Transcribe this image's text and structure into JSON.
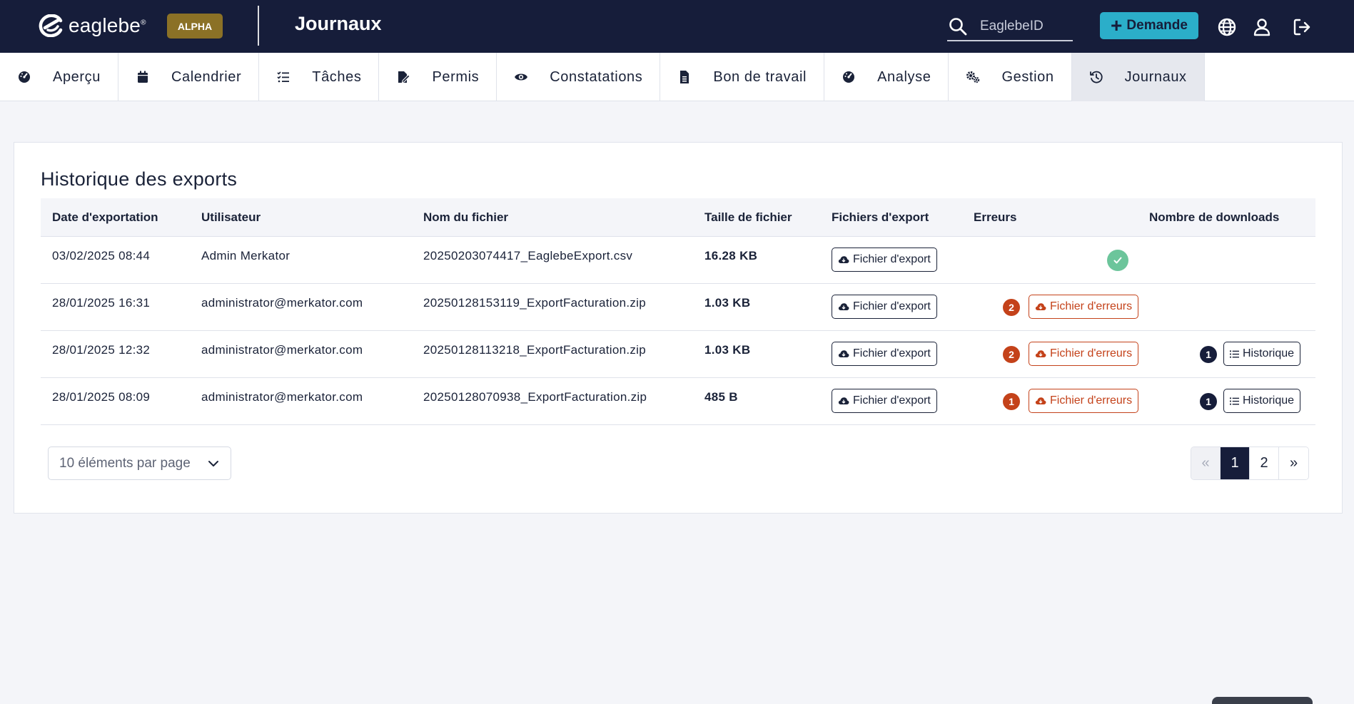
{
  "header": {
    "brand": "eaglebe",
    "brand_mark": "®",
    "env_badge": "ALPHA",
    "page_title": "Journaux",
    "search_placeholder": "EaglebeID",
    "new_request_label": "Demande",
    "icons": [
      "search-icon",
      "plus-icon",
      "globe-icon",
      "user-icon",
      "logout-icon"
    ]
  },
  "tabs": [
    {
      "label": "Aperçu",
      "icon": "dashboard-icon",
      "active": false
    },
    {
      "label": "Calendrier",
      "icon": "calendar-icon",
      "active": false
    },
    {
      "label": "Tâches",
      "icon": "checklist-icon",
      "active": false
    },
    {
      "label": "Permis",
      "icon": "permit-icon",
      "active": false
    },
    {
      "label": "Constatations",
      "icon": "eye-icon",
      "active": false
    },
    {
      "label": "Bon de travail",
      "icon": "document-icon",
      "active": false
    },
    {
      "label": "Analyse",
      "icon": "analysis-icon",
      "active": false
    },
    {
      "label": "Gestion",
      "icon": "cogs-icon",
      "active": false
    },
    {
      "label": "Journaux",
      "icon": "history-icon",
      "active": true
    }
  ],
  "card": {
    "title": "Historique des exports",
    "columns": [
      "Date d'exportation",
      "Utilisateur",
      "Nom du fichier",
      "Taille de fichier",
      "Fichiers d'export",
      "Erreurs",
      "Nombre de downloads"
    ],
    "export_button_label": "Fichier d'export",
    "error_button_label": "Fichier d'erreurs",
    "history_button_label": "Historique",
    "rows": [
      {
        "date": "03/02/2025 08:44",
        "user": "Admin Merkator",
        "file": "20250203074417_EaglebeExport.csv",
        "size": "16.28 KB",
        "errors": "",
        "downloads": ""
      },
      {
        "date": "28/01/2025 16:31",
        "user": "administrator@merkator.com",
        "file": "20250128153119_ExportFacturation.zip",
        "size": "1.03 KB",
        "errors": "2",
        "downloads": ""
      },
      {
        "date": "28/01/2025 12:32",
        "user": "administrator@merkator.com",
        "file": "20250128113218_ExportFacturation.zip",
        "size": "1.03 KB",
        "errors": "2",
        "downloads": "1"
      },
      {
        "date": "28/01/2025 08:09",
        "user": "administrator@merkator.com",
        "file": "20250128070938_ExportFacturation.zip",
        "size": "485 B",
        "errors": "1",
        "downloads": "1"
      }
    ]
  },
  "pagination": {
    "per_page_label": "10 éléments par page",
    "prev": "«",
    "pages": [
      "1",
      "2"
    ],
    "current_page": "1",
    "next": "»"
  },
  "colors": {
    "navy": "#161d3a",
    "accent": "#2baec9",
    "alpha_badge": "#8b7126",
    "error": "#c4421a",
    "success": "#6cc59b"
  }
}
